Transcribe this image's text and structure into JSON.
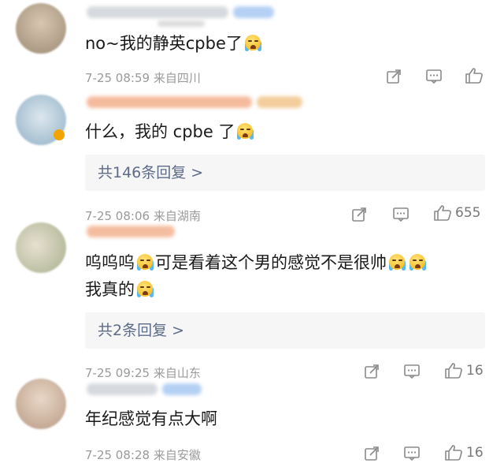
{
  "colors": {
    "link": "#5d6b88",
    "meta": "#9a9a9a",
    "reply_bg": "#f6f6f6"
  },
  "comments": [
    {
      "text_parts": [
        "no~我的静英cpbe了"
      ],
      "time": "7-25 08:59",
      "location": "来自四川",
      "likes": ""
    },
    {
      "text_parts": [
        "什么，我的 cpbe 了"
      ],
      "time": "",
      "location": "",
      "likes": "",
      "replies": "共146条回复 >"
    },
    {
      "time": "7-25 08:06",
      "location": "来自湖南",
      "likes": "655"
    },
    {
      "text_parts": [
        "呜呜呜",
        "可是看着这个男的感觉不是很帅",
        "我真的"
      ],
      "replies": "共2条回复 >"
    },
    {
      "time": "7-25 09:25",
      "location": "来自山东",
      "likes": "16"
    },
    {
      "text_parts": [
        "年纪感觉有点大啊"
      ],
      "time": "7-25 08:28",
      "location": "来自安徽",
      "likes": "16"
    }
  ],
  "icons": [
    "share-icon",
    "comment-icon",
    "like-icon",
    "crying-emoji-icon"
  ]
}
